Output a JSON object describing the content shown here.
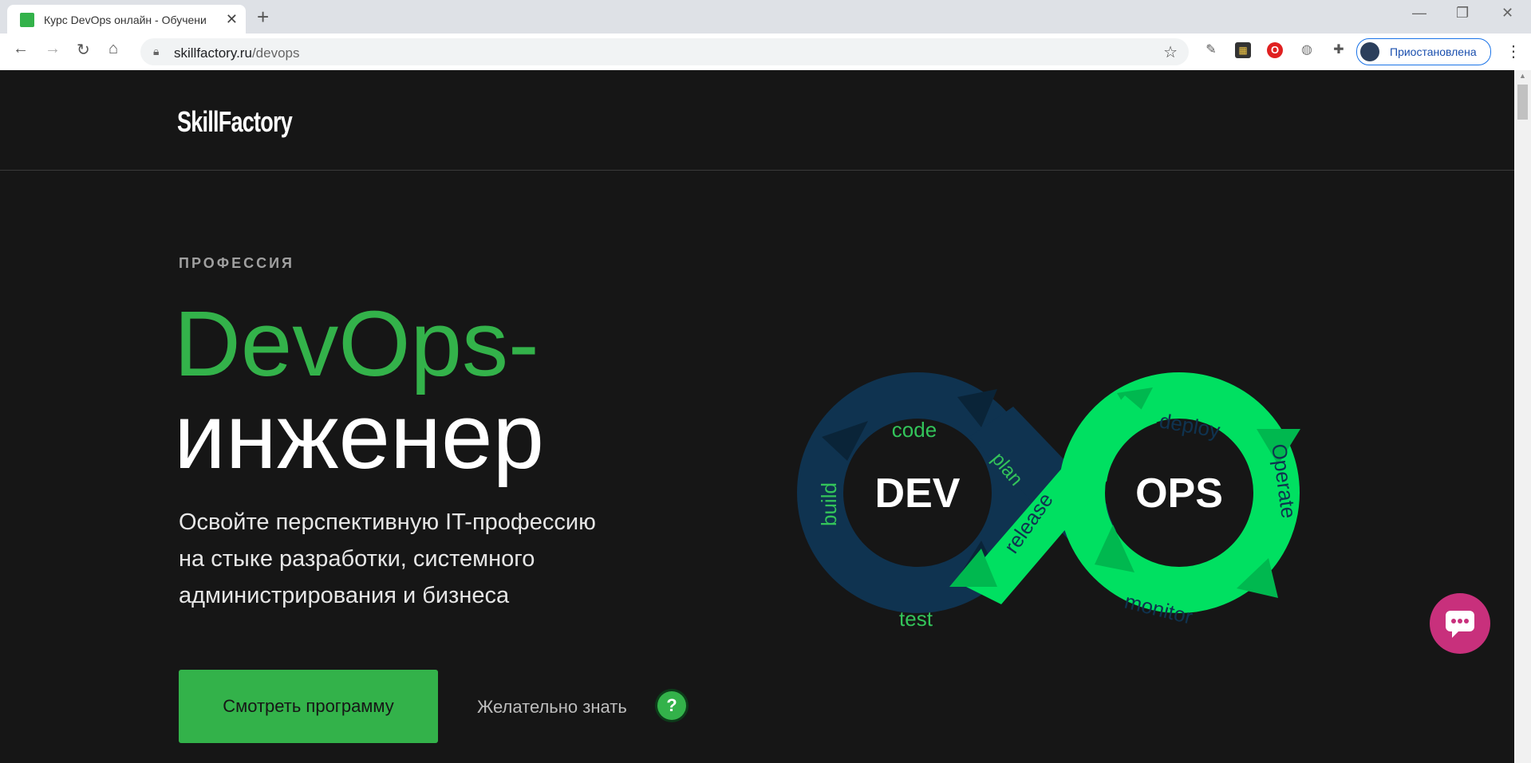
{
  "browser": {
    "tab_title": "Курс DevOps онлайн - Обучени",
    "tab_close": "✕",
    "new_tab": "+",
    "url_domain": "skillfactory.ru",
    "url_path": "/devops",
    "profile_status": "Приостановлена",
    "window": {
      "minimize": "—",
      "restore": "❐",
      "close": "✕"
    }
  },
  "site": {
    "logo": "SkillFactory",
    "eyebrow": "ПРОФЕССИЯ",
    "title_line1": "DevOps-",
    "title_line2": "инженер",
    "lead_line1": "Освойте перспективную IT-профессию",
    "lead_line2": "на стыке разработки, системного",
    "lead_line3": "администрирования и бизнеса",
    "cta_label": "Смотреть программу",
    "hint_label": "Желательно знать",
    "hint_icon": "?"
  },
  "diagram": {
    "left_center": "DEV",
    "right_center": "OPS",
    "stages": {
      "code": "code",
      "build": "build",
      "test": "test",
      "plan": "plan",
      "release": "release",
      "deploy": "deploy",
      "operate": "Operate",
      "monitor": "monitor"
    }
  },
  "colors": {
    "brand_green": "#33b24a",
    "neon_green": "#00e061",
    "dark_blue": "#0f3350",
    "chat_pink": "#c8307c",
    "background": "#161616"
  },
  "icons": [
    "favicon-icon",
    "back-icon",
    "forward-icon",
    "reload-icon",
    "home-icon",
    "lock-icon",
    "star-icon",
    "eyedropper-icon",
    "extension-icon",
    "opera-icon",
    "puzzle-icon",
    "menu-icon",
    "chat-icon"
  ]
}
